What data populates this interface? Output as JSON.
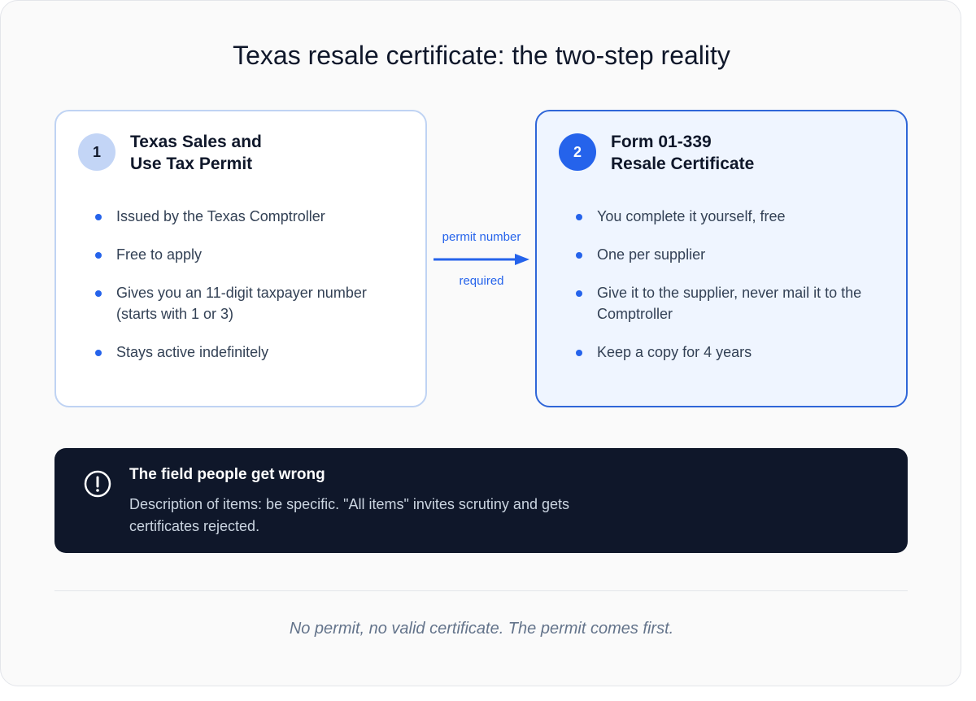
{
  "title": "Texas resale certificate: the two-step reality",
  "steps": [
    {
      "number": "1",
      "heading_line1": "Texas Sales and",
      "heading_line2": "Use Tax Permit",
      "bullets": [
        "Issued by the Texas Comptroller",
        "Free to apply",
        "Gives you an 11-digit taxpayer number (starts with 1 or 3)",
        "Stays active indefinitely"
      ]
    },
    {
      "number": "2",
      "heading_line1": "Form 01-339",
      "heading_line2": "Resale Certificate",
      "bullets": [
        "You complete it yourself, free",
        "One per supplier",
        "Give it to the supplier, never mail it to the Comptroller",
        "Keep a copy for 4 years"
      ]
    }
  ],
  "connector": {
    "top_label": "permit number",
    "bottom_label": "required"
  },
  "callout": {
    "icon": "alert-circle-icon",
    "title": "The field people get wrong",
    "body": "Description of items: be specific. \"All items\" invites scrutiny and gets certificates rejected."
  },
  "footer": "No permit, no valid certificate. The permit comes first.",
  "colors": {
    "accent": "#2563eb",
    "dark": "#0f172a",
    "light_card": "#eff5ff"
  }
}
